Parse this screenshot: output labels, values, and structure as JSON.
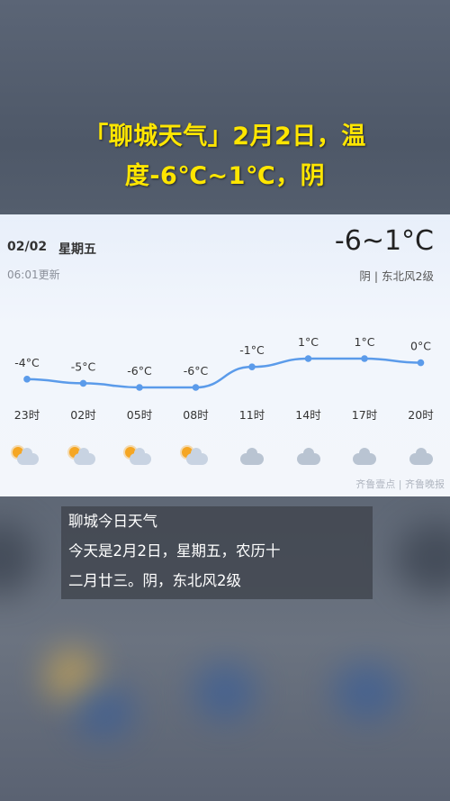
{
  "headline": {
    "line1": "「聊城天气」2月2日，温",
    "line2": "度-6℃~1℃，阴"
  },
  "card": {
    "date": "02/02",
    "weekday": "星期五",
    "update": "06:01更新",
    "temp_range": "-6~1°C",
    "condition_wind": "阴 | 东北风2级",
    "watermark": "齐鲁壹点 | 齐鲁晚报"
  },
  "hourly": {
    "hours": [
      "23时",
      "02时",
      "05时",
      "08时",
      "11时",
      "14时",
      "17时",
      "20时"
    ],
    "temps": [
      "-4°C",
      "-5°C",
      "-6°C",
      "-6°C",
      "-1°C",
      "1°C",
      "1°C",
      "0°C"
    ],
    "values": [
      -4,
      -5,
      -6,
      -6,
      -1,
      1,
      1,
      0
    ],
    "icons": [
      "partly-cloudy-icon",
      "partly-cloudy-icon",
      "partly-cloudy-icon",
      "partly-cloudy-icon",
      "cloudy-icon",
      "cloudy-icon",
      "cloudy-icon",
      "cloudy-icon"
    ],
    "line_color": "#5b9bea"
  },
  "caption": {
    "line1": "聊城今日天气",
    "line2": "今天是2月2日，星期五，农历十",
    "line3": "二月廿三。阴，东北风2级"
  }
}
